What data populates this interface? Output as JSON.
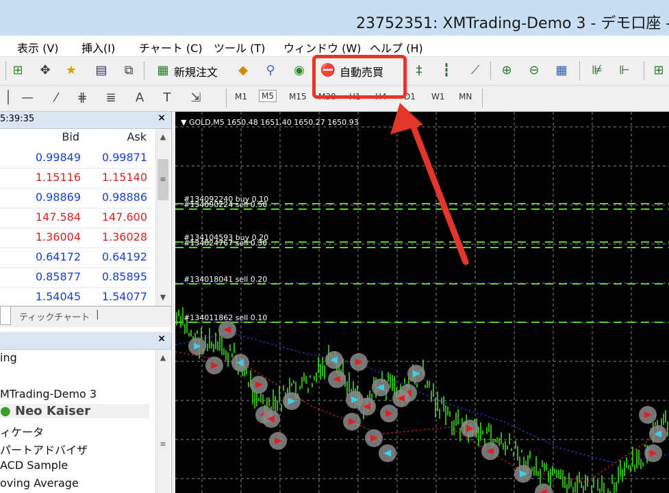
{
  "window": {
    "title": "23752351: XMTrading-Demo 3 - デモ口座 - "
  },
  "menu": [
    "表示 (V)",
    "挿入(I)",
    "チャート (C)",
    "ツール (T)",
    "ウィンドウ (W)",
    "ヘルプ (H)"
  ],
  "toolbar": {
    "new_order_label": "新規注文",
    "auto_trading_label": "自動売買"
  },
  "timeframes": [
    "M1",
    "M5",
    "M15",
    "M30",
    "H1",
    "H4",
    "D1",
    "W1",
    "MN"
  ],
  "active_timeframe": "M5",
  "market_watch": {
    "time": "5:39:35",
    "bid_header": "Bid",
    "ask_header": "Ask",
    "rows": [
      {
        "bid": "0.99849",
        "ask": "0.99871",
        "color": "#1a3fd1"
      },
      {
        "bid": "1.15116",
        "ask": "1.15140",
        "color": "#d42424"
      },
      {
        "bid": "0.98869",
        "ask": "0.98886",
        "color": "#1a3fd1"
      },
      {
        "bid": "147.584",
        "ask": "147.600",
        "color": "#d42424"
      },
      {
        "bid": "1.36004",
        "ask": "1.36028",
        "color": "#d42424"
      },
      {
        "bid": "0.64172",
        "ask": "0.64192",
        "color": "#1a3fd1"
      },
      {
        "bid": "0.85877",
        "ask": "0.85895",
        "color": "#1a3fd1"
      },
      {
        "bid": "1.54045",
        "ask": "1.54077",
        "color": "#1a3fd1"
      }
    ],
    "tab_tick_chart": "ティックチャート"
  },
  "navigator": {
    "items": [
      "ing",
      "MTrading-Demo 3",
      "Neo Kaiser",
      "ィケータ",
      "パートアドバイザ",
      "ACD Sample",
      "oving Average"
    ]
  },
  "chart": {
    "header": "GOLD,M5  1650.48 1651.40 1650.27 1650.93",
    "orders": [
      "#134092240 buy 0.10",
      "#134090224 sell 0.50",
      "#134104593 buy 0.20",
      "#134024767 sell 0.30",
      "#134018041 sell 0.20",
      "#134011862 sell 0.10"
    ],
    "candle_color": "#3fdc1e",
    "order_line_color": "#5ad12c"
  }
}
